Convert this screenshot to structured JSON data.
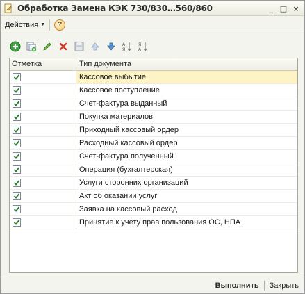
{
  "window": {
    "title": "Обработка  Замена КЭК 730/830…560/860"
  },
  "menubar": {
    "actions_label": "Действия",
    "help_label": "?"
  },
  "toolbar": {
    "buttons": [
      "add-icon",
      "copy-icon",
      "edit-icon",
      "delete-icon",
      "save-icon",
      "move-up-icon",
      "move-down-icon",
      "sort-asc-icon",
      "sort-desc-icon"
    ]
  },
  "table": {
    "columns": [
      "Отметка",
      "Тип документа"
    ],
    "rows": [
      {
        "checked": true,
        "type": "Кассовое выбытие"
      },
      {
        "checked": true,
        "type": "Кассовое поступление"
      },
      {
        "checked": true,
        "type": "Счет-фактура выданный"
      },
      {
        "checked": true,
        "type": "Покупка материалов"
      },
      {
        "checked": true,
        "type": "Приходный кассовый ордер"
      },
      {
        "checked": true,
        "type": "Расходный кассовый ордер"
      },
      {
        "checked": true,
        "type": "Счет-фактура полученный"
      },
      {
        "checked": true,
        "type": "Операция (бухгалтерская)"
      },
      {
        "checked": true,
        "type": "Услуги сторонних организаций"
      },
      {
        "checked": true,
        "type": "Акт об оказании услуг"
      },
      {
        "checked": true,
        "type": "Заявка на кассовый расход"
      },
      {
        "checked": true,
        "type": "Принятие к учету прав пользования ОС, НПА"
      }
    ]
  },
  "footer": {
    "run_label": "Выполнить",
    "close_label": "Закрыть"
  },
  "colors": {
    "window_bg": "#f4f4ee",
    "selected_row": "#fdf3c4",
    "check_green": "#2f7a2f"
  }
}
